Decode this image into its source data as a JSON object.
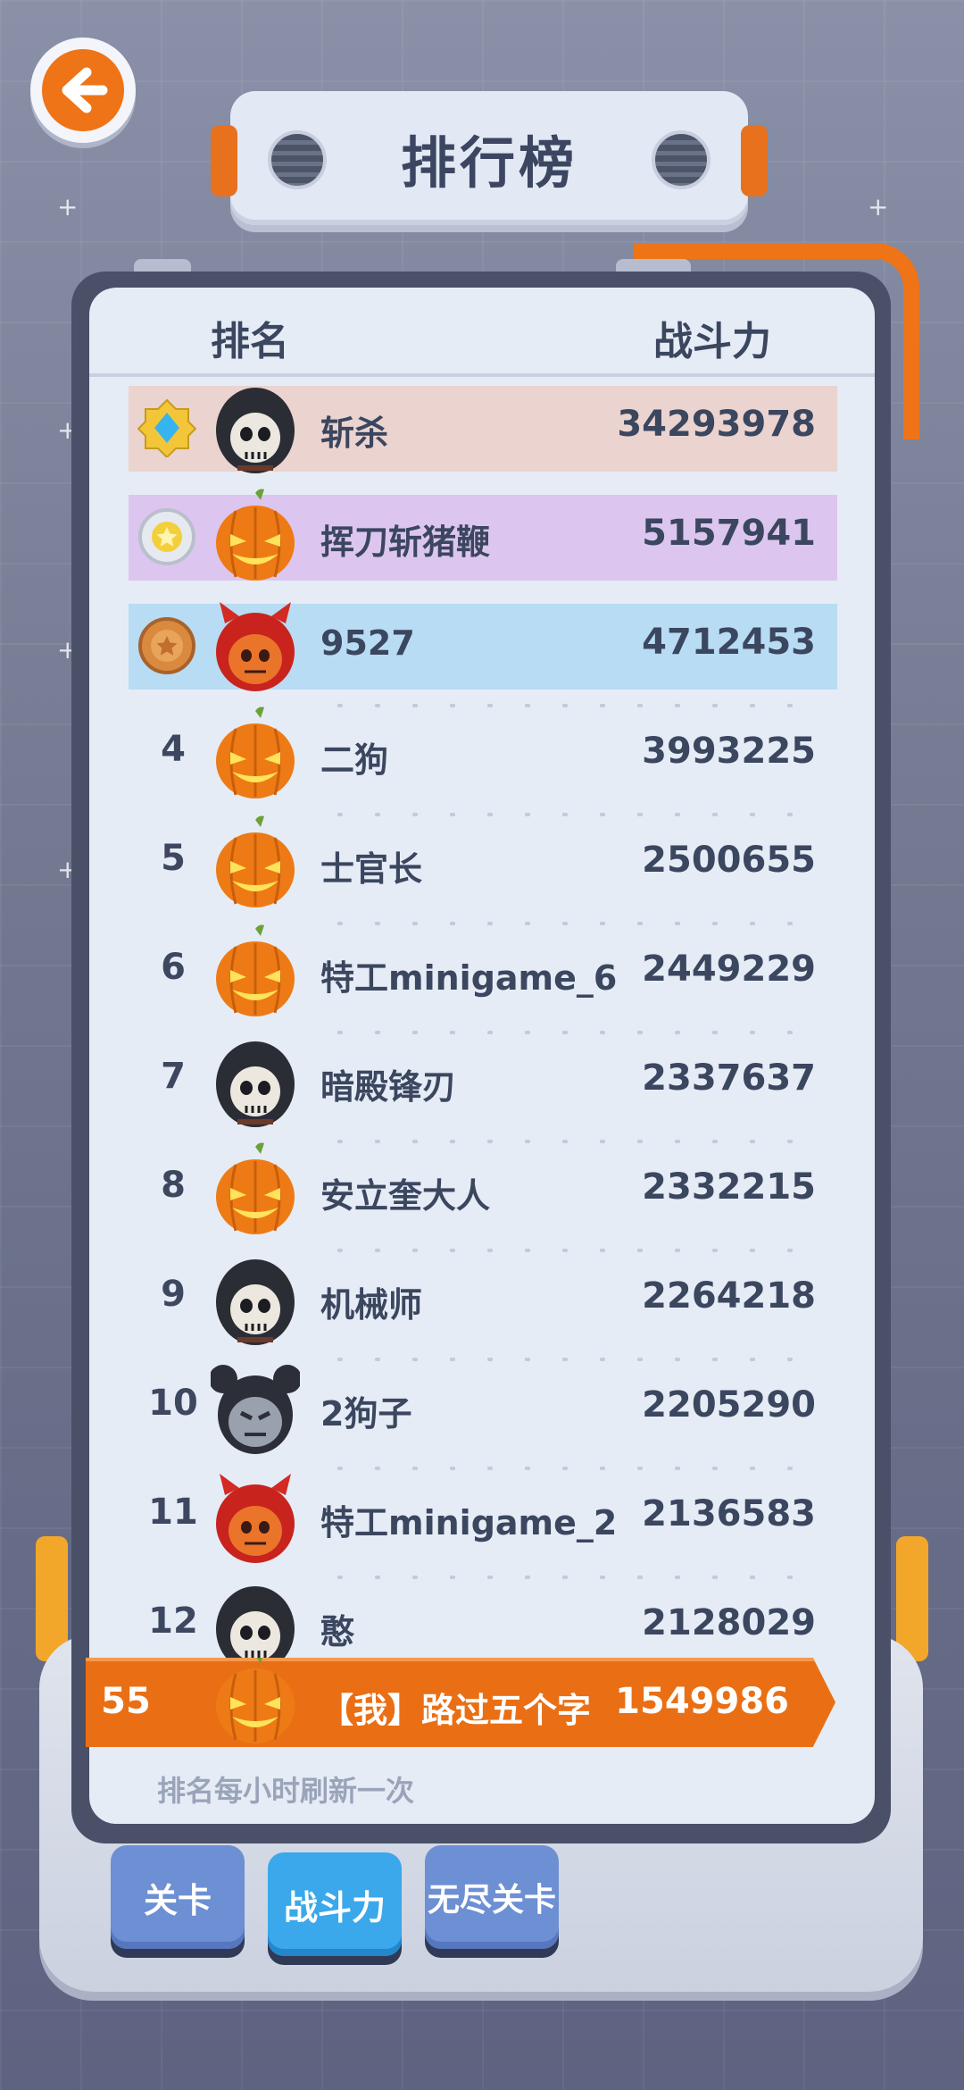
{
  "title": "排行榜",
  "columns": {
    "rank": "排名",
    "power": "战斗力"
  },
  "colors": {
    "accent": "#ee7417",
    "row1": "#ebd3cf",
    "row2": "#dcc6ef",
    "row3": "#b8dcf3",
    "tab_active": "#3aa8ea",
    "tab_inactive": "#6d8fd3"
  },
  "rows": [
    {
      "rank": "1",
      "medal": "diamond-medal-icon",
      "avatar": "reaper-avatar",
      "name": "斩杀",
      "power": "34293978"
    },
    {
      "rank": "2",
      "medal": "silver-medal-icon",
      "avatar": "pumpkin-avatar",
      "name": "挥刀斩猪鞭",
      "power": "5157941"
    },
    {
      "rank": "3",
      "medal": "bronze-medal-icon",
      "avatar": "devil-avatar",
      "name": "9527",
      "power": "4712453"
    },
    {
      "rank": "4",
      "avatar": "pumpkin-avatar",
      "name": "二狗",
      "power": "3993225"
    },
    {
      "rank": "5",
      "avatar": "pumpkin-avatar",
      "name": "士官长",
      "power": "2500655"
    },
    {
      "rank": "6",
      "avatar": "pumpkin-avatar",
      "name": "特工minigame_6",
      "power": "2449229"
    },
    {
      "rank": "7",
      "avatar": "reaper-avatar",
      "name": "暗殿锋刃",
      "power": "2337637"
    },
    {
      "rank": "8",
      "avatar": "pumpkin-avatar",
      "name": "安立奎大人",
      "power": "2332215"
    },
    {
      "rank": "9",
      "avatar": "reaper-avatar",
      "name": "机械师",
      "power": "2264218"
    },
    {
      "rank": "10",
      "avatar": "mouse-ear-avatar",
      "name": "2狗子",
      "power": "2205290"
    },
    {
      "rank": "11",
      "avatar": "devil-avatar",
      "name": "特工minigame_2",
      "power": "2136583"
    },
    {
      "rank": "12",
      "avatar": "reaper-avatar",
      "name": "憨",
      "power": "2128029"
    }
  ],
  "me": {
    "rank": "55",
    "avatar": "pumpkin-avatar",
    "name": "【我】路过五个字",
    "power": "1549986"
  },
  "footer_note": "排名每小时刷新一次",
  "tabs": [
    {
      "label": "关卡",
      "active": false
    },
    {
      "label": "战斗力",
      "active": true
    },
    {
      "label": "无尽关卡",
      "active": false
    }
  ]
}
